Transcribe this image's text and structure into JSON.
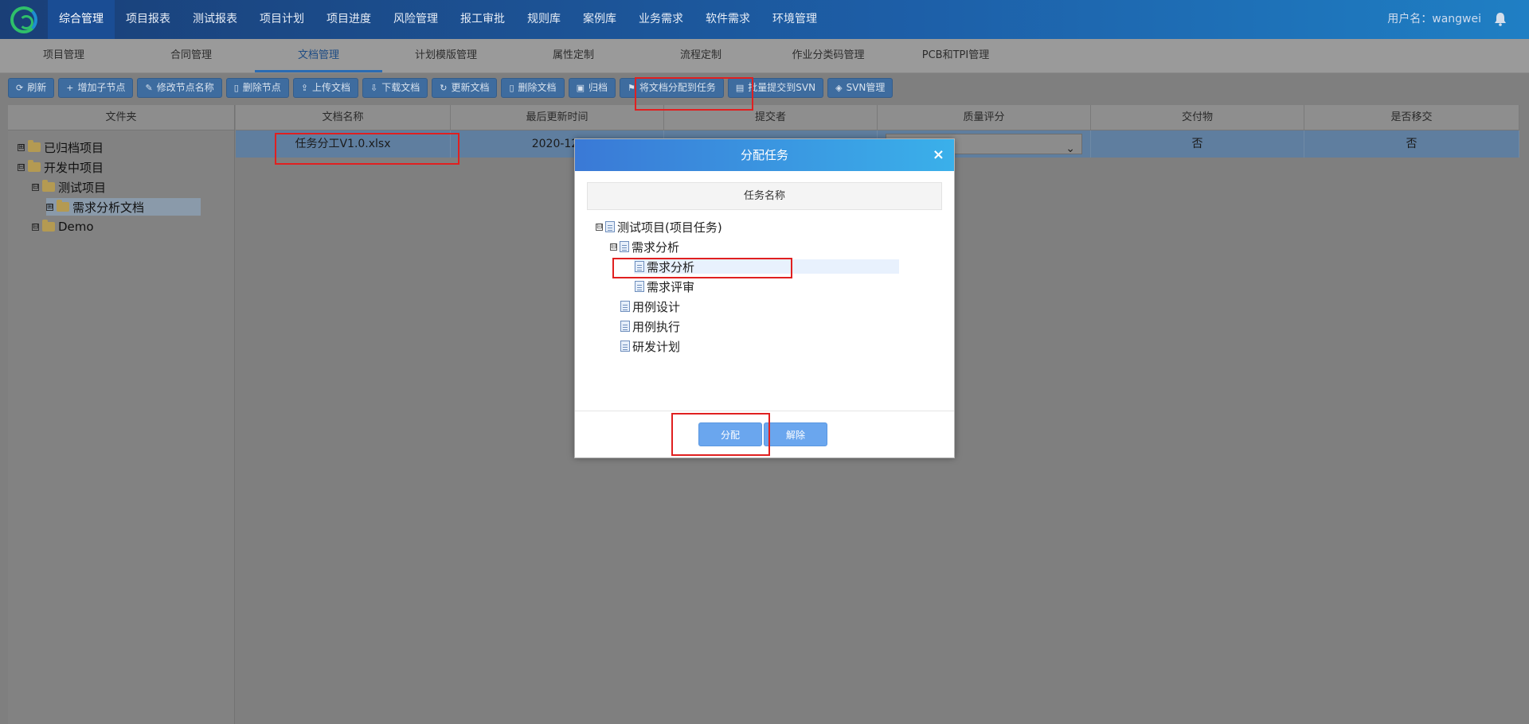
{
  "topnav": {
    "items": [
      "综合管理",
      "项目报表",
      "测试报表",
      "项目计划",
      "项目进度",
      "风险管理",
      "报工审批",
      "规则库",
      "案例库",
      "业务需求",
      "软件需求",
      "环境管理"
    ],
    "active": "综合管理",
    "user_label": "用户名：wangwei"
  },
  "subtabs": {
    "items": [
      "项目管理",
      "合同管理",
      "文档管理",
      "计划模版管理",
      "属性定制",
      "流程定制",
      "作业分类码管理",
      "PCB和TPI管理"
    ],
    "active": "文档管理"
  },
  "toolbar": {
    "buttons": [
      {
        "label": "刷新",
        "icon": "refresh-icon"
      },
      {
        "label": "增加子节点",
        "icon": "plus-icon"
      },
      {
        "label": "修改节点名称",
        "icon": "edit-icon"
      },
      {
        "label": "删除节点",
        "icon": "trash-icon"
      },
      {
        "label": "上传文档",
        "icon": "upload-icon"
      },
      {
        "label": "下载文档",
        "icon": "download-icon"
      },
      {
        "label": "更新文档",
        "icon": "update-icon"
      },
      {
        "label": "删除文档",
        "icon": "trash-icon"
      },
      {
        "label": "归档",
        "icon": "archive-icon"
      },
      {
        "label": "将文档分配到任务",
        "icon": "flag-icon"
      },
      {
        "label": "批量提交到SVN",
        "icon": "save-icon"
      },
      {
        "label": "SVN管理",
        "icon": "svn-icon"
      }
    ]
  },
  "folder_panel": {
    "header": "文件夹",
    "tree": [
      {
        "label": "已归档项目",
        "toggle": "⊞"
      },
      {
        "label": "开发中项目",
        "toggle": "⊟"
      },
      {
        "label": "测试项目",
        "toggle": "⊟"
      },
      {
        "label": "需求分析文档",
        "toggle": "⊞"
      },
      {
        "label": "Demo",
        "toggle": "⊟"
      }
    ]
  },
  "doc_table": {
    "columns": [
      "文档名称",
      "最后更新时间",
      "提交者",
      "质量评分",
      "交付物",
      "是否移交"
    ],
    "row": {
      "name": "任务分工V1.0.xlsx",
      "updated": "2020-12-",
      "submitter": "",
      "quality": "",
      "deliverable": "否",
      "transferred": "否"
    }
  },
  "dialog": {
    "title": "分配任务",
    "close": "×",
    "column": "任务名称",
    "tree": [
      {
        "label": "测试项目(项目任务)",
        "toggle": "⊟"
      },
      {
        "label": "需求分析",
        "toggle": "⊟"
      },
      {
        "label": "需求分析",
        "toggle": ""
      },
      {
        "label": "需求评审",
        "toggle": ""
      },
      {
        "label": "用例设计",
        "toggle": ""
      },
      {
        "label": "用例执行",
        "toggle": ""
      },
      {
        "label": "研发计划",
        "toggle": ""
      }
    ],
    "assign_label": "分配",
    "release_label": "解除"
  },
  "colors": {
    "topbar": "#1d5fa8",
    "dialog_header": "#3a8fe0",
    "highlight": "#e02020",
    "button": "#6aa6ee"
  }
}
